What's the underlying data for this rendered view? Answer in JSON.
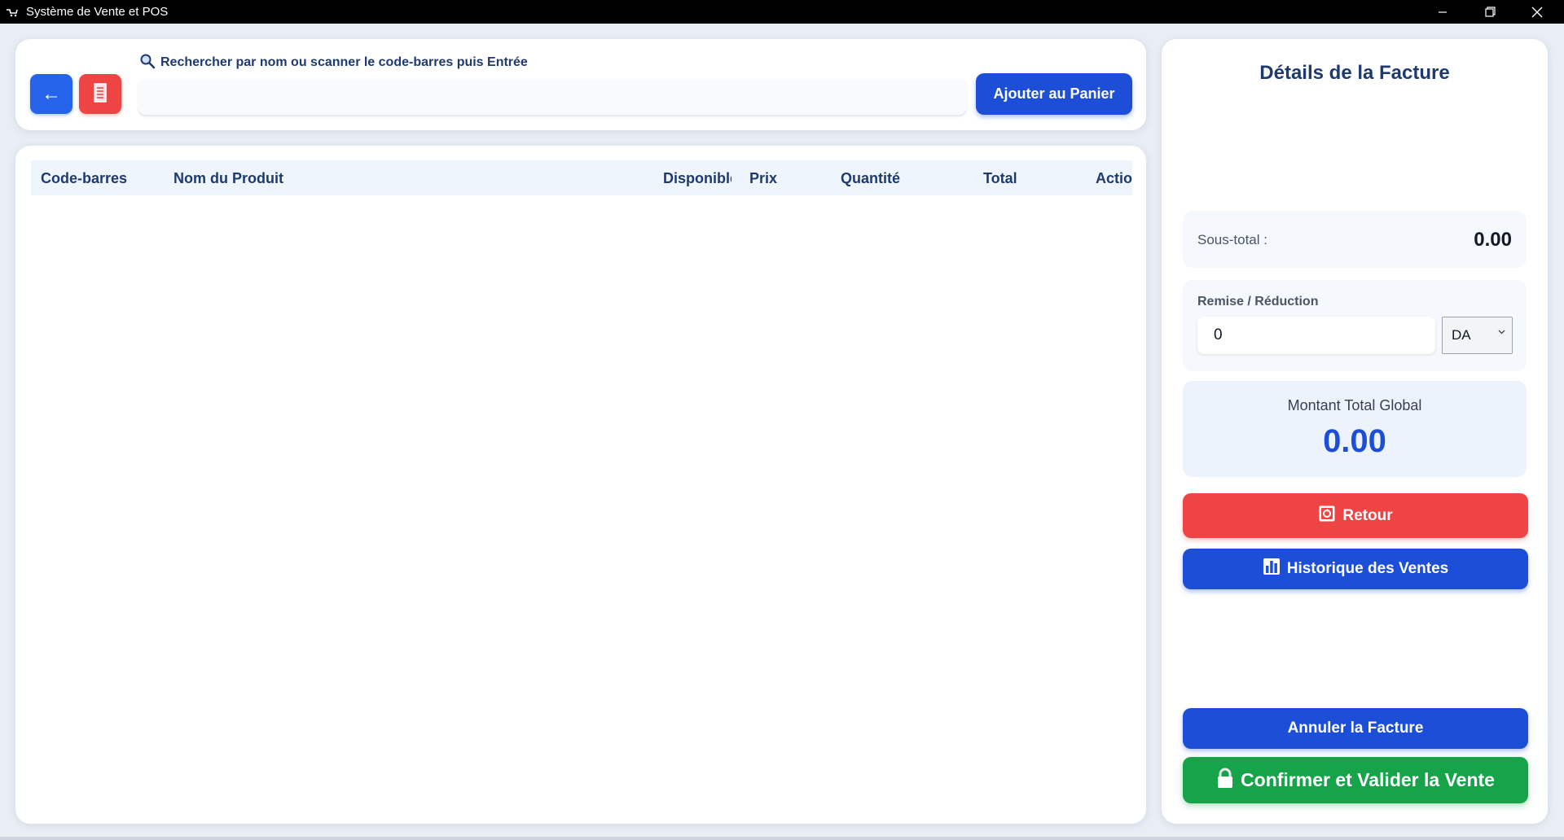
{
  "window": {
    "title": "Système de Vente et POS"
  },
  "search": {
    "label": "Rechercher par nom ou scanner le code-barres puis Entrée",
    "value": "",
    "placeholder": "",
    "add_button": "Ajouter au Panier",
    "back_button": "←"
  },
  "table": {
    "columns": [
      "Code-barres",
      "Nom du Produit",
      "Disponible",
      "Prix",
      "Quantité",
      "Total",
      "Action"
    ],
    "rows": []
  },
  "invoice": {
    "title": "Détails de la Facture",
    "subtotal_label": "Sous-total :",
    "subtotal_value": "0.00",
    "discount_label": "Remise / Réduction",
    "discount_value": "0",
    "currency_selected": "DA",
    "total_label": "Montant Total Global",
    "total_value": "0.00",
    "return_button": "Retour",
    "history_button": "Historique des Ventes",
    "cancel_button": "Annuler la Facture",
    "confirm_button": "Confirmer et Valider la Vente"
  },
  "colors": {
    "primary": "#1d4ed8",
    "danger": "#ef4444",
    "success": "#16a34a",
    "heading": "#1e3a6e"
  },
  "icons": {
    "back": "arrow-left-icon",
    "red_action": "receipt-icon",
    "search": "search-icon",
    "return": "return-icon",
    "history": "bar-chart-icon",
    "confirm": "lock-icon"
  }
}
